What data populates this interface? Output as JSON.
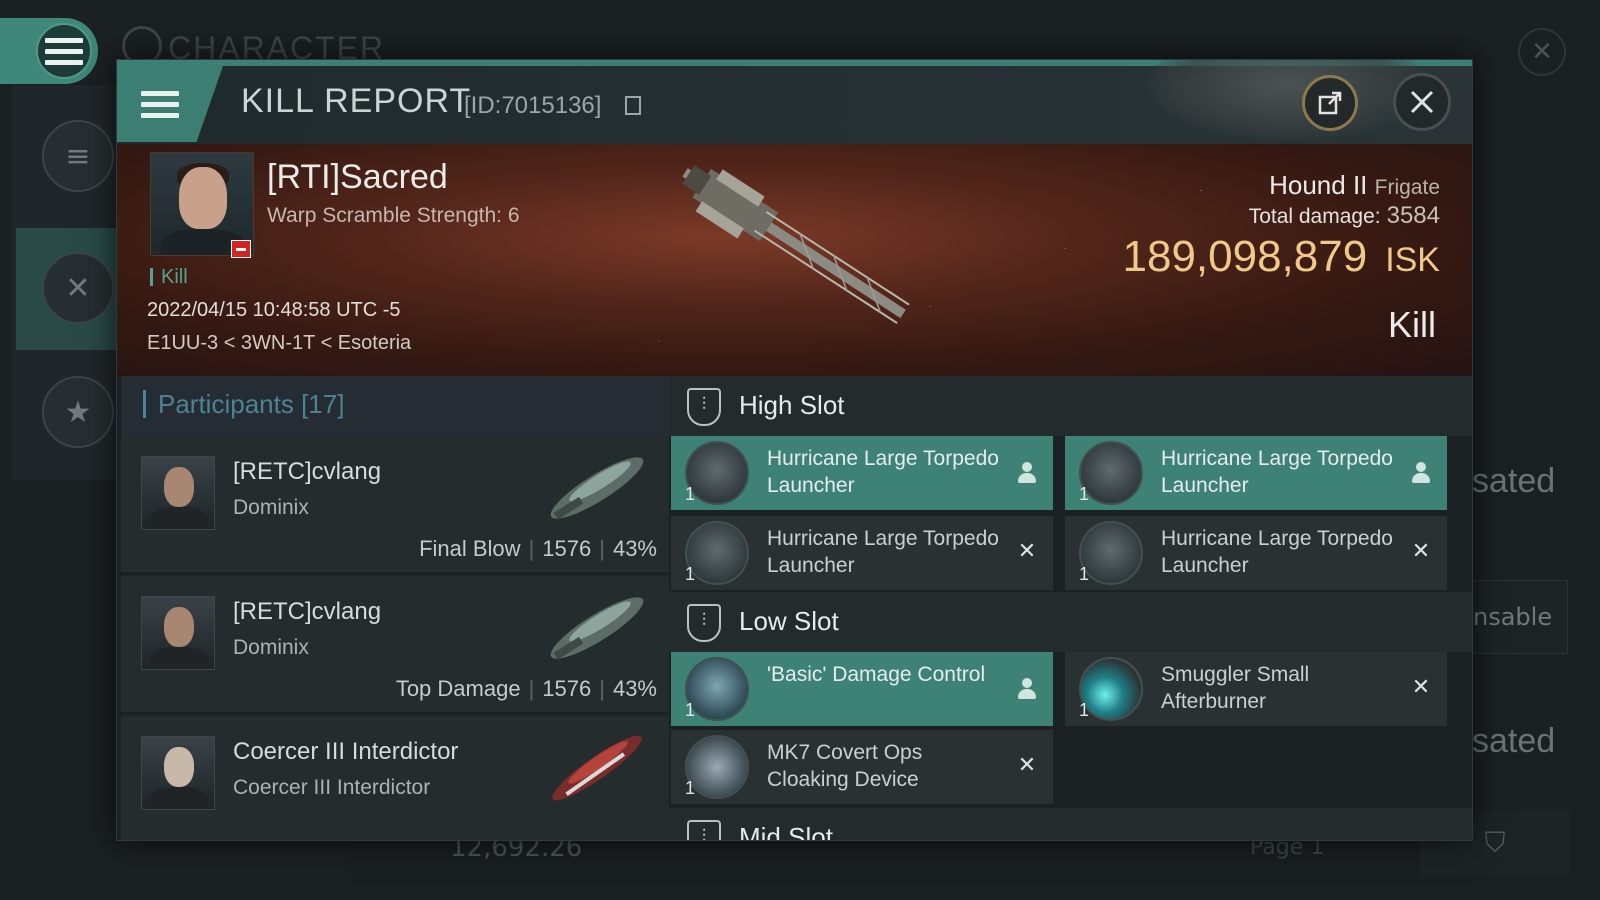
{
  "background": {
    "title": "CHARACTER",
    "side_texts": [
      "sated",
      "nsable",
      "sated"
    ],
    "bottom_value": "12,692.26",
    "bottom_page": "Page 1"
  },
  "dialog": {
    "title": "KILL REPORT",
    "id_label": "[ID:7015136]",
    "share_icon": "share-icon",
    "close_icon": "close-icon"
  },
  "victim": {
    "name": "[RTI]Sacred",
    "subtitle": "Warp Scramble Strength: 6",
    "tag": "Kill",
    "datetime": "2022/04/15 10:48:58 UTC -5",
    "location": "E1UU-3 < 3WN-1T < Esoteria",
    "ship": "Hound II",
    "ship_class": "Frigate",
    "total_damage_label": "Total damage:",
    "total_damage": "3584",
    "isk_value": "189,098,879",
    "isk_unit": "ISK",
    "result": "Kill"
  },
  "participants": {
    "title": "Participants",
    "count": "[17]",
    "rows": [
      {
        "name": "[RETC]cvlang",
        "ship": "Dominix",
        "role": "Final Blow",
        "damage": "1576",
        "percent": "43%"
      },
      {
        "name": "[RETC]cvlang",
        "ship": "Dominix",
        "role": "Top Damage",
        "damage": "1576",
        "percent": "43%"
      },
      {
        "name": "Coercer III Interdictor",
        "ship": "Coercer III Interdictor",
        "role": "",
        "damage": "",
        "percent": ""
      }
    ]
  },
  "fittings": {
    "high_slot": {
      "title": "High Slot",
      "modules": [
        {
          "name": "Hurricane Large Torpedo Launcher",
          "qty": "1",
          "status": "dropped"
        },
        {
          "name": "Hurricane Large Torpedo Launcher",
          "qty": "1",
          "status": "dropped"
        },
        {
          "name": "Hurricane Large Torpedo Launcher",
          "qty": "1",
          "status": "destroyed"
        },
        {
          "name": "Hurricane Large Torpedo Launcher",
          "qty": "1",
          "status": "destroyed"
        }
      ]
    },
    "low_slot": {
      "title": "Low Slot",
      "modules": [
        {
          "name": "'Basic' Damage Control",
          "qty": "1",
          "status": "dropped"
        },
        {
          "name": "Smuggler Small Afterburner",
          "qty": "1",
          "status": "destroyed"
        },
        {
          "name": "MK7 Covert Ops Cloaking Device",
          "qty": "1",
          "status": "destroyed"
        }
      ]
    },
    "mid_slot": {
      "title": "Mid Slot"
    }
  },
  "colors": {
    "accent": "#3d8275",
    "isk": "#f0c98a",
    "participants_title": "#4d8294"
  }
}
